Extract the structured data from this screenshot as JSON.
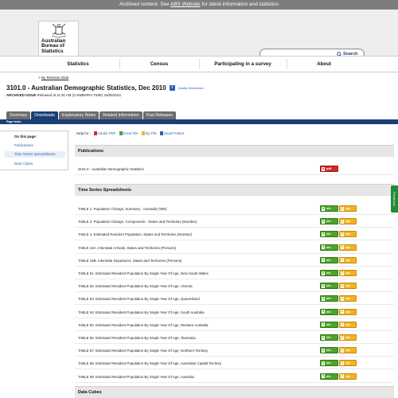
{
  "archive_banner": {
    "prefix": "Archived content. See ",
    "link": "ABS Website",
    "suffix": " for latest information and statistics"
  },
  "logo": {
    "text": "Australian Bureau of Statistics"
  },
  "search": {
    "placeholder": "",
    "button_label": "Search",
    "icon": "search-icon"
  },
  "nav": [
    "Statistics",
    "Census",
    "Participating in a survey",
    "About"
  ],
  "breadcrumb": {
    "prefix": "> ",
    "link": "By Release Date"
  },
  "page": {
    "title": "3101.0 - Australian Demographic Statistics, Dec 2010",
    "quality_link": "Quality Declaration",
    "issue_label": "ARCHIVED ISSUE",
    "issue_text": " Released at 11:30 AM (CANBERRA TIME) 23/06/2011"
  },
  "tabs": [
    {
      "label": "Summary",
      "active": false
    },
    {
      "label": "Downloads",
      "active": true
    },
    {
      "label": "Explanatory Notes",
      "active": false
    },
    {
      "label": "Related Information",
      "active": false
    },
    {
      "label": "Past Releases",
      "active": false
    }
  ],
  "page_tools_label": "Page tools:",
  "sidebar": {
    "heading": "On this page:",
    "links": [
      "Publications",
      "Time Series Spreadsheets",
      "Data Cubes"
    ]
  },
  "help": {
    "label": "Help for :",
    "items": [
      "Adobe PDF",
      "Excel File",
      "Zip File",
      "SuperTABLE"
    ]
  },
  "publications": {
    "heading": "Publications",
    "rows": [
      {
        "label": "3101.0 - Australian Demographic Statistics",
        "button": "pdf"
      }
    ]
  },
  "spreadsheets": {
    "heading": "Time Series Spreadsheets",
    "xls_label": "xls",
    "zip_label": "zip",
    "rows": [
      "TABLE 1. Population Change, Summary - Australia ('000)",
      "TABLE 2. Population Change, Components - States and Territories (Number)",
      "TABLE 4. Estimated Resident Population, States and Territories (Number)",
      "TABLE 16A. Interstate Arrivals, States and Territories (Persons)",
      "TABLE 16B. Interstate Departures, States and Territories (Persons)",
      "TABLE 51. Estimated Resident Population By Single Year Of Age, New South Wales",
      "TABLE 52. Estimated Resident Population By Single Year Of Age, Victoria",
      "TABLE 53. Estimated Resident Population By Single Year Of Age, Queensland",
      "TABLE 54. Estimated Resident Population By Single Year Of Age, South Australia",
      "TABLE 55. Estimated Resident Population By Single Year Of Age, Western Australia",
      "TABLE 56. Estimated Resident Population By Single Year Of Age, Tasmania",
      "TABLE 57. Estimated Resident Population By Single Year Of Age, Northern Territory",
      "TABLE 58. Estimated Resident Population By Single Year Of Age, Australian Capital Territory",
      "TABLE 59. Estimated Resident Population By Single Year Of Age, Australia"
    ]
  },
  "data_cubes": {
    "heading": "Data Cubes"
  },
  "feedback_label": "Feedback",
  "colors": {
    "nav_blue": "#1a3f77",
    "xls_green": "#4ea32a",
    "zip_orange": "#f1b326",
    "pdf_red": "#d42a2a"
  }
}
